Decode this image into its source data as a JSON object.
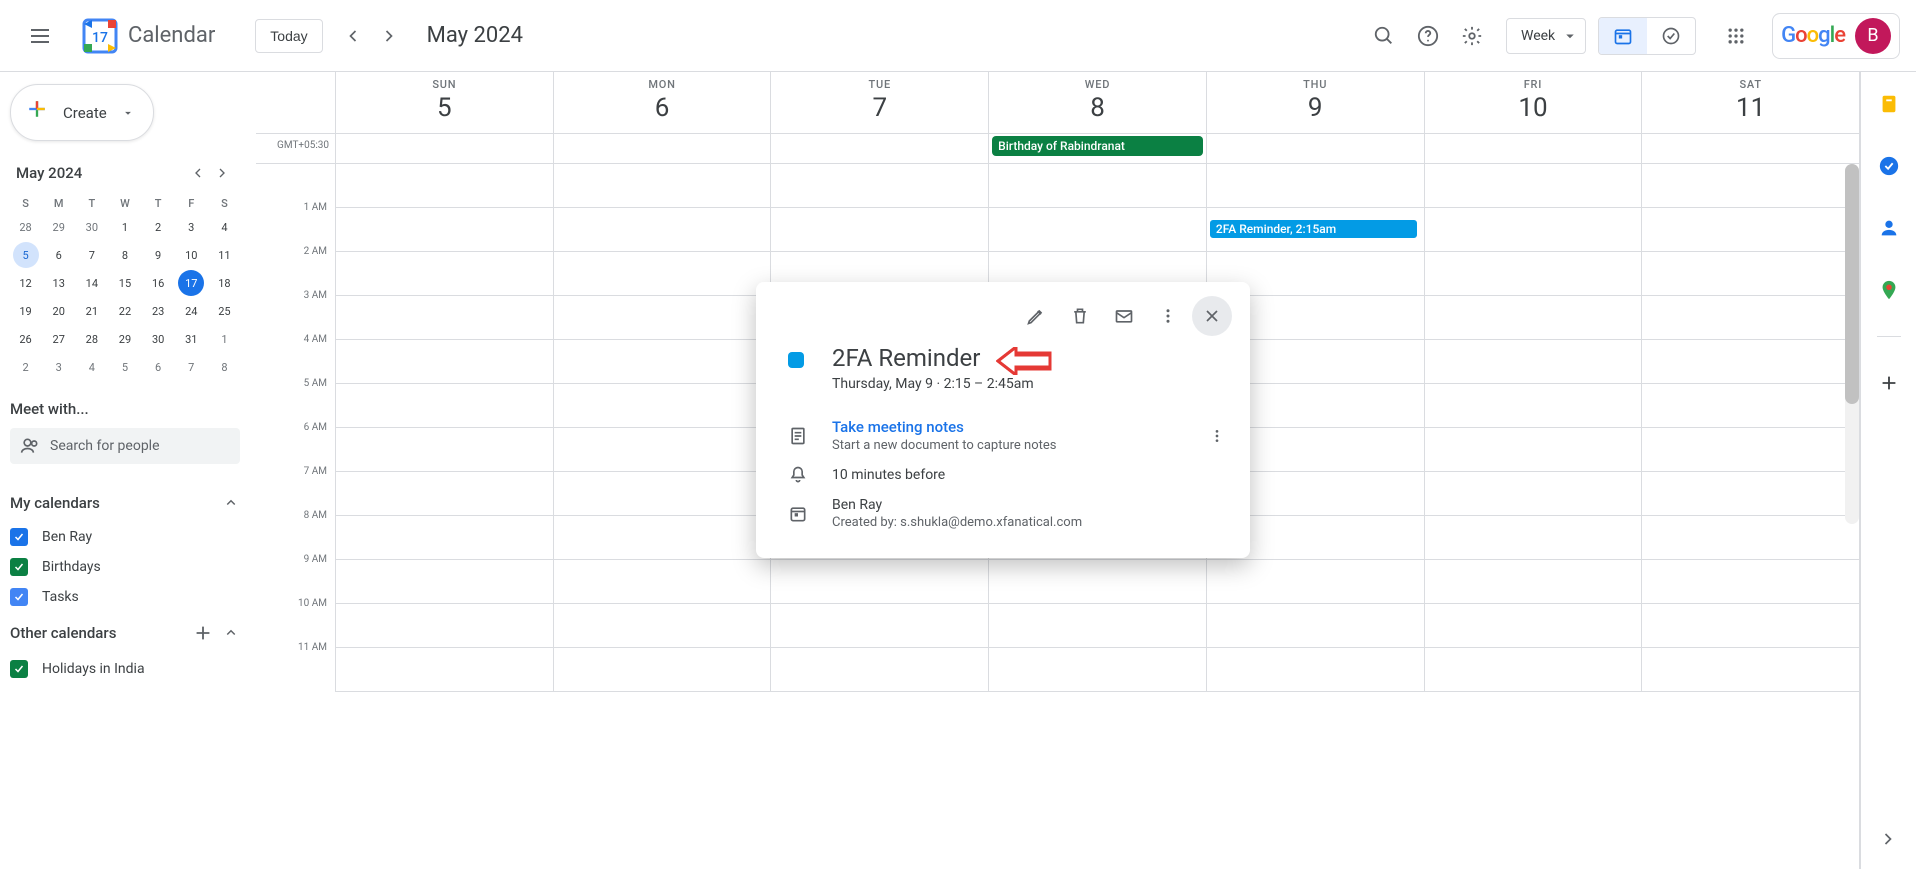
{
  "header": {
    "appTitle": "Calendar",
    "todayLabel": "Today",
    "monthLabel": "May 2024",
    "viewLabel": "Week",
    "avatarLetter": "B",
    "calendarIconDay": "17"
  },
  "sidebar": {
    "createLabel": "Create",
    "miniCal": {
      "title": "May 2024",
      "dow": [
        "S",
        "M",
        "T",
        "W",
        "T",
        "F",
        "S"
      ],
      "days": [
        {
          "n": "28",
          "other": true
        },
        {
          "n": "29",
          "other": true
        },
        {
          "n": "30",
          "other": true
        },
        {
          "n": "1"
        },
        {
          "n": "2"
        },
        {
          "n": "3"
        },
        {
          "n": "4"
        },
        {
          "n": "5",
          "selected": true
        },
        {
          "n": "6"
        },
        {
          "n": "7"
        },
        {
          "n": "8"
        },
        {
          "n": "9"
        },
        {
          "n": "10"
        },
        {
          "n": "11"
        },
        {
          "n": "12"
        },
        {
          "n": "13"
        },
        {
          "n": "14"
        },
        {
          "n": "15"
        },
        {
          "n": "16"
        },
        {
          "n": "17",
          "today": true
        },
        {
          "n": "18"
        },
        {
          "n": "19"
        },
        {
          "n": "20"
        },
        {
          "n": "21"
        },
        {
          "n": "22"
        },
        {
          "n": "23"
        },
        {
          "n": "24"
        },
        {
          "n": "25"
        },
        {
          "n": "26"
        },
        {
          "n": "27"
        },
        {
          "n": "28"
        },
        {
          "n": "29"
        },
        {
          "n": "30"
        },
        {
          "n": "31"
        },
        {
          "n": "1",
          "other": true
        },
        {
          "n": "2",
          "other": true
        },
        {
          "n": "3",
          "other": true
        },
        {
          "n": "4",
          "other": true
        },
        {
          "n": "5",
          "other": true
        },
        {
          "n": "6",
          "other": true
        },
        {
          "n": "7",
          "other": true
        },
        {
          "n": "8",
          "other": true
        }
      ]
    },
    "meetWithLabel": "Meet with...",
    "searchPeoplePlaceholder": "Search for people",
    "myCalendarsLabel": "My calendars",
    "calendars": [
      {
        "label": "Ben Ray",
        "color": "cb-blue"
      },
      {
        "label": "Birthdays",
        "color": "cb-green"
      },
      {
        "label": "Tasks",
        "color": "cb-blue2"
      }
    ],
    "otherCalendarsLabel": "Other calendars",
    "otherCalendars": [
      {
        "label": "Holidays in India",
        "color": "cb-green"
      }
    ]
  },
  "grid": {
    "tz": "GMT+05:30",
    "days": [
      {
        "dow": "SUN",
        "num": "5"
      },
      {
        "dow": "MON",
        "num": "6"
      },
      {
        "dow": "TUE",
        "num": "7"
      },
      {
        "dow": "WED",
        "num": "8"
      },
      {
        "dow": "THU",
        "num": "9"
      },
      {
        "dow": "FRI",
        "num": "10"
      },
      {
        "dow": "SAT",
        "num": "11"
      }
    ],
    "timeLabels": [
      "1 AM",
      "2 AM",
      "3 AM",
      "4 AM",
      "5 AM",
      "6 AM",
      "7 AM",
      "8 AM",
      "9 AM",
      "10 AM",
      "11 AM"
    ],
    "alldayEvents": [
      {
        "dayIndex": 3,
        "label": "Birthday of Rabindranat"
      }
    ],
    "events": [
      {
        "dayIndex": 4,
        "topPx": 55,
        "label": "2FA Reminder, 2:15am"
      }
    ]
  },
  "popup": {
    "title": "2FA Reminder",
    "timeStr": "Thursday, May 9  ·  2:15 – 2:45am",
    "meetingNotesLink": "Take meeting notes",
    "meetingNotesSub": "Start a new document to capture notes",
    "reminder": "10 minutes before",
    "owner": "Ben Ray",
    "createdBy": "Created by: s.shukla@demo.xfanatical.com"
  }
}
